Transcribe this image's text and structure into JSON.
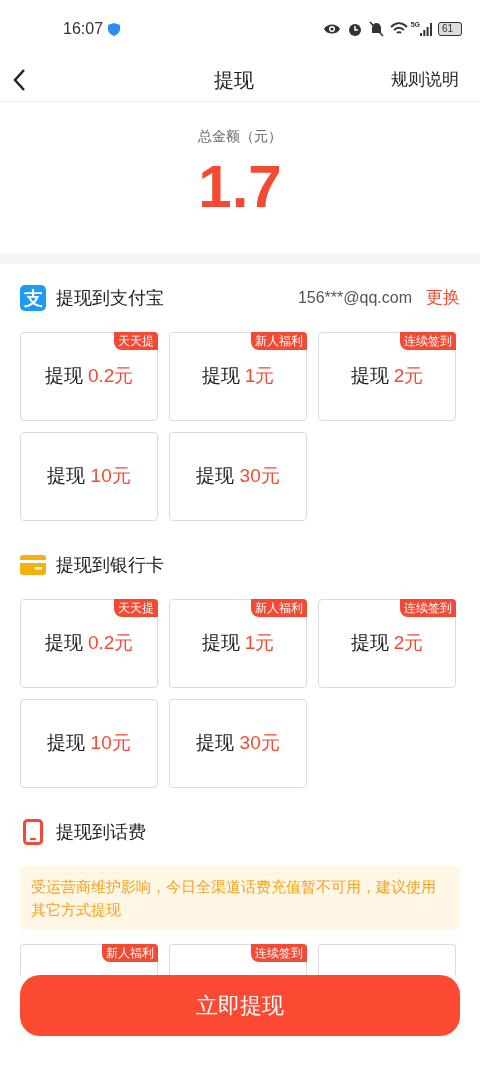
{
  "status_bar": {
    "time": "16:07",
    "network": "5G",
    "battery": "61"
  },
  "header": {
    "title": "提现",
    "action": "规则说明"
  },
  "balance": {
    "label": "总金额（元）",
    "amount": "1.7"
  },
  "sections": [
    {
      "kind": "alipay",
      "logo": "支",
      "title": "提现到支付宝",
      "account": "156***@qq.com",
      "change": "更换",
      "options": [
        {
          "prefix": "提现",
          "amount": "0.2元",
          "tag": "天天提"
        },
        {
          "prefix": "提现",
          "amount": "1元",
          "tag": "新人福利"
        },
        {
          "prefix": "提现",
          "amount": "2元",
          "tag": "连续签到"
        },
        {
          "prefix": "提现",
          "amount": "10元"
        },
        {
          "prefix": "提现",
          "amount": "30元"
        }
      ]
    },
    {
      "kind": "bank",
      "title": "提现到银行卡",
      "options": [
        {
          "prefix": "提现",
          "amount": "0.2元",
          "tag": "天天提"
        },
        {
          "prefix": "提现",
          "amount": "1元",
          "tag": "新人福利"
        },
        {
          "prefix": "提现",
          "amount": "2元",
          "tag": "连续签到"
        },
        {
          "prefix": "提现",
          "amount": "10元"
        },
        {
          "prefix": "提现",
          "amount": "30元"
        }
      ]
    },
    {
      "kind": "phone",
      "title": "提现到话费",
      "notice": "受运营商维护影响，今日全渠道话费充值暂不可用，建议使用其它方式提现",
      "options": [
        {
          "kind": "partial",
          "tag": "新人福利"
        },
        {
          "kind": "partial",
          "tag": "连续签到"
        },
        {
          "kind": "partial"
        }
      ]
    }
  ],
  "submit": "立即提现"
}
